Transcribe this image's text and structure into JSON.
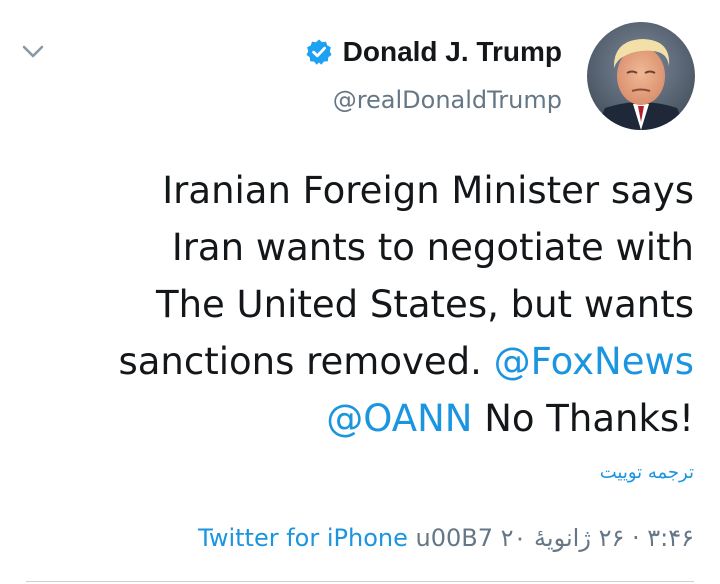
{
  "author": {
    "name": "Donald J. Trump",
    "handle": "@realDonaldTrump",
    "verified": true
  },
  "tweet": {
    "lines": [
      [
        {
          "text": "Iranian Foreign Minister says",
          "mention": false
        }
      ],
      [
        {
          "text": "Iran wants to negotiate with",
          "mention": false
        }
      ],
      [
        {
          "text": "The United States, but wants",
          "mention": false
        }
      ],
      [
        {
          "text": "sanctions removed. ",
          "mention": false
        },
        {
          "text": "@FoxNews",
          "mention": true
        }
      ],
      [
        {
          "text": "@OANN",
          "mention": true
        },
        {
          "text": " No Thanks!",
          "mention": false
        }
      ]
    ]
  },
  "translate_label": "ترجمه توییت",
  "meta": {
    "time": "۳:۴۶ · ۲۶ ژانویهٔ ۲۰",
    "separator": "u00B7",
    "client": "Twitter for iPhone"
  },
  "icons": {
    "chevron": "chevron-down-icon",
    "verified": "verified-badge-icon"
  },
  "colors": {
    "link": "#1b95e0",
    "secondary_text": "#657786",
    "text": "#14171a",
    "verified_badge": "#1da1f2"
  }
}
